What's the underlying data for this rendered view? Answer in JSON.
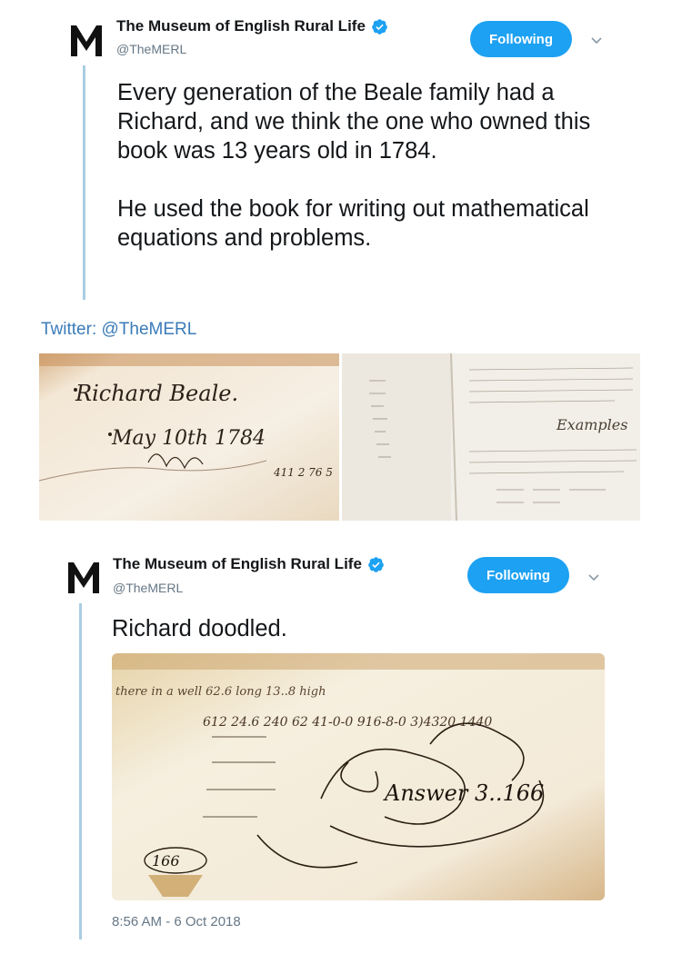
{
  "tweet1": {
    "display_name": "The Museum of English Rural Life",
    "handle": "@TheMERL",
    "follow_label": "Following",
    "text_p1": "Every generation of the Beale family had a Richard, and we think the one who owned this book was 13 years old in 1784.",
    "text_p2": "He used the book for writing out mathematical equations and problems."
  },
  "credit": "Twitter: @TheMERL",
  "photo_left": {
    "script_name": "Richard Beale.",
    "script_date": "May 10th 1784",
    "script_numbers": "411  2  76 5"
  },
  "photo_right": {
    "script_heading": "Examples"
  },
  "tweet2": {
    "display_name": "The Museum of English Rural Life",
    "handle": "@TheMERL",
    "follow_label": "Following",
    "text": "Richard doodled.",
    "timestamp": "8:56 AM - 6 Oct 2018",
    "photo_script_answer": "Answer 3..166",
    "photo_script_top": "there in a well 62.6 long 13..8 high",
    "photo_script_left": "612 24.6 240 62 41-0-0 916-8-0 3)4320 1440",
    "photo_script_bottom": "166"
  },
  "colors": {
    "accent": "#1da1f2",
    "thread": "#a9cde3",
    "credit": "#3a7bb8",
    "muted": "#657786"
  },
  "icons": [
    "merl-logo-icon",
    "verified-badge-icon",
    "chevron-down-icon"
  ]
}
